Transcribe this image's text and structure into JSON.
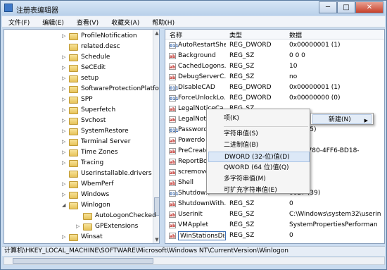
{
  "window": {
    "title": "注册表编辑器",
    "minimize": "─",
    "maximize": "□",
    "close": "✕"
  },
  "menubar": {
    "items": [
      "文件(F)",
      "编辑(E)",
      "查看(V)",
      "收藏夹(A)",
      "帮助(H)"
    ]
  },
  "tree": {
    "items": [
      {
        "label": "ProfileNotification",
        "expander": "▷"
      },
      {
        "label": "related.desc",
        "expander": ""
      },
      {
        "label": "Schedule",
        "expander": "▷"
      },
      {
        "label": "SeCEdit",
        "expander": "▷"
      },
      {
        "label": "setup",
        "expander": "▷"
      },
      {
        "label": "SoftwareProtectionPlatfo",
        "expander": "▷"
      },
      {
        "label": "SPP",
        "expander": "▷"
      },
      {
        "label": "Superfetch",
        "expander": "▷"
      },
      {
        "label": "Svchost",
        "expander": "▷"
      },
      {
        "label": "SystemRestore",
        "expander": "▷"
      },
      {
        "label": "Terminal Server",
        "expander": "▷"
      },
      {
        "label": "Time Zones",
        "expander": "▷"
      },
      {
        "label": "Tracing",
        "expander": "▷"
      },
      {
        "label": "Userinstallable.drivers",
        "expander": ""
      },
      {
        "label": "WbemPerf",
        "expander": "▷"
      },
      {
        "label": "Windows",
        "expander": "▷"
      },
      {
        "label": "Winlogon",
        "expander": "◢"
      },
      {
        "label": "AutoLogonChecked",
        "expander": "",
        "child": true
      },
      {
        "label": "GPExtensions",
        "expander": "▷",
        "child": true
      },
      {
        "label": "Winsat",
        "expander": "▷"
      },
      {
        "label": "WinSATAPI",
        "expander": "▷"
      },
      {
        "label": "WUDF",
        "expander": "▷"
      }
    ]
  },
  "list": {
    "columns": {
      "name": "名称",
      "type": "类型",
      "data": "数据"
    },
    "rows": [
      {
        "name": "AutoRestartShell",
        "type": "REG_DWORD",
        "data": "0x00000001 (1)",
        "icon": "bin"
      },
      {
        "name": "Background",
        "type": "REG_SZ",
        "data": "0 0 0",
        "icon": "str"
      },
      {
        "name": "CachedLogons...",
        "type": "REG_SZ",
        "data": "10",
        "icon": "str"
      },
      {
        "name": "DebugServerC...",
        "type": "REG_SZ",
        "data": "no",
        "icon": "str"
      },
      {
        "name": "DisableCAD",
        "type": "REG_DWORD",
        "data": "0x00000001 (1)",
        "icon": "bin"
      },
      {
        "name": "ForceUnlockLo...",
        "type": "REG_DWORD",
        "data": "0x00000000 (0)",
        "icon": "bin"
      },
      {
        "name": "LegalNoticeCa...",
        "type": "REG_SZ",
        "data": "",
        "icon": "str"
      },
      {
        "name": "LegalNot",
        "type": "",
        "data": "",
        "icon": "str"
      },
      {
        "name": "Password",
        "type": "",
        "data": "0005 (5)",
        "icon": "bin"
      },
      {
        "name": "Powerdo",
        "type": "",
        "data": "",
        "icon": "str"
      },
      {
        "name": "PreCreate",
        "type": "",
        "data": "1A4-1780-4FF6-BD18-",
        "icon": "str"
      },
      {
        "name": "ReportBo",
        "type": "",
        "data": "",
        "icon": "str"
      },
      {
        "name": "scremove",
        "type": "",
        "data": "",
        "icon": "str"
      },
      {
        "name": "Shell",
        "type": "",
        "data": "er.exe",
        "icon": "str"
      },
      {
        "name": "Shutdown",
        "type": "",
        "data": "0027 (39)",
        "icon": "bin"
      },
      {
        "name": "ShutdownWith...",
        "type": "REG_SZ",
        "data": "0",
        "icon": "str"
      },
      {
        "name": "Userinit",
        "type": "REG_SZ",
        "data": "C:\\Windows\\system32\\userin",
        "icon": "str"
      },
      {
        "name": "VMApplet",
        "type": "REG_SZ",
        "data": "SystemPropertiesPerforman",
        "icon": "str"
      },
      {
        "name": "WinStationsDis...",
        "type": "REG_SZ",
        "data": "0",
        "icon": "str",
        "editing": true
      }
    ]
  },
  "context_menu": {
    "items": [
      "项(K)",
      "字符串值(S)",
      "二进制值(B)",
      "DWORD (32-位)值(D)",
      "QWORD (64 位)值(Q)",
      "多字符串值(M)",
      "可扩充字符串值(E)"
    ],
    "highlighted": "DWORD (32-位)值(D)"
  },
  "submenu_parent": {
    "label": "新建(N)",
    "arrow": "▶"
  },
  "statusbar": {
    "path": "计算机\\HKEY_LOCAL_MACHINE\\SOFTWARE\\Microsoft\\Windows NT\\CurrentVersion\\Winlogon"
  },
  "colors": {
    "accent": "#3c6fb5",
    "highlight": "#dce8f7",
    "title_bg": "#c9dbef"
  }
}
